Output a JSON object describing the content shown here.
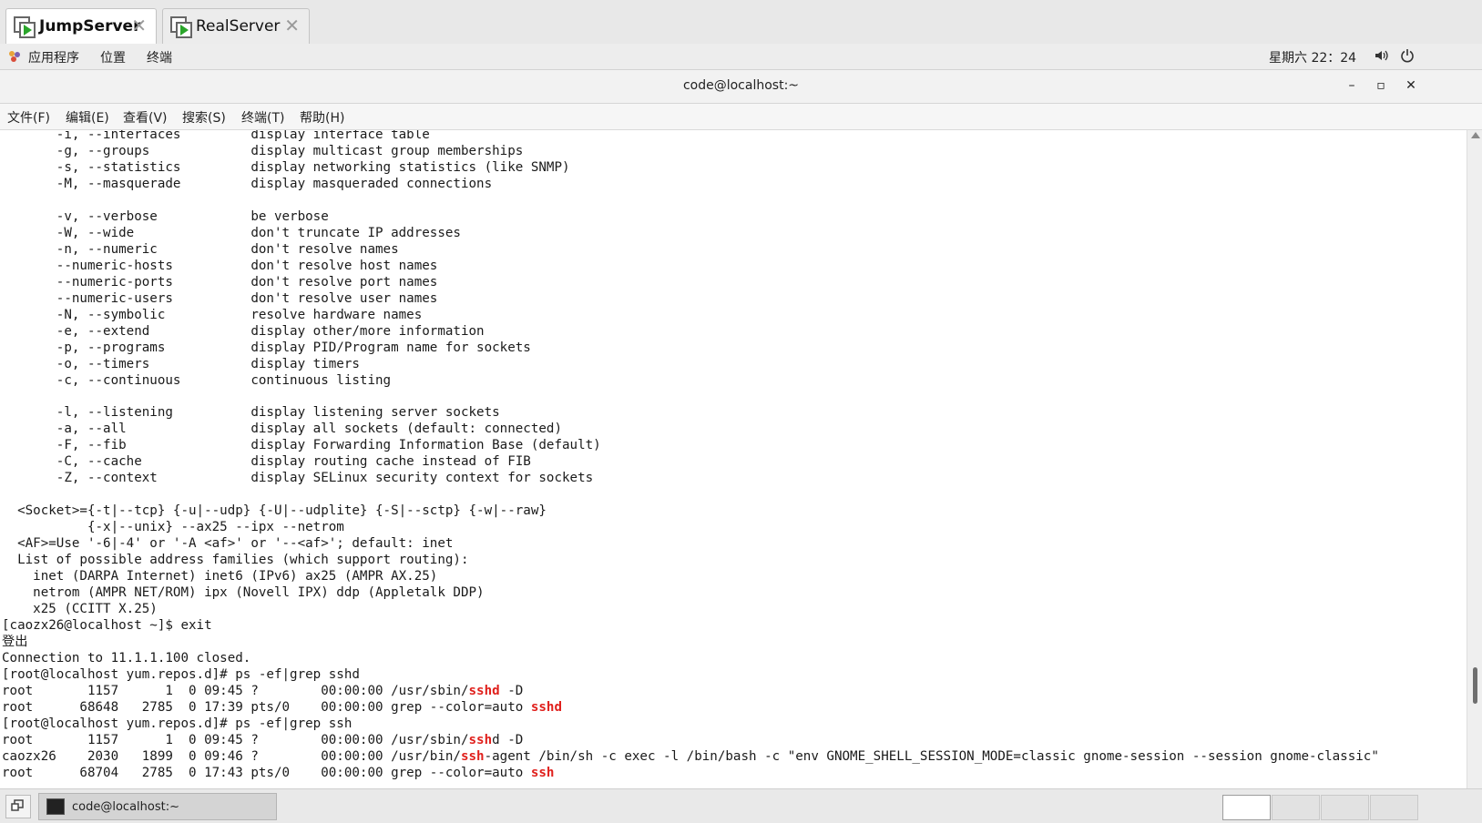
{
  "tabs": [
    {
      "label": "JumpServer",
      "active": true
    },
    {
      "label": "RealServer",
      "active": false
    }
  ],
  "topbar": {
    "apps": "应用程序",
    "places": "位置",
    "terminal": "终端",
    "clock": "星期六 22：24"
  },
  "window": {
    "title": "code@localhost:~"
  },
  "menu": [
    "文件(F)",
    "编辑(E)",
    "查看(V)",
    "搜索(S)",
    "终端(T)",
    "帮助(H)"
  ],
  "terminal_lines": [
    [
      {
        "t": "       -i, --interfaces         display interface table"
      }
    ],
    [
      {
        "t": "       -g, --groups             display multicast group memberships"
      }
    ],
    [
      {
        "t": "       -s, --statistics         display networking statistics (like SNMP)"
      }
    ],
    [
      {
        "t": "       -M, --masquerade         display masqueraded connections"
      }
    ],
    [
      {
        "t": ""
      }
    ],
    [
      {
        "t": "       -v, --verbose            be verbose"
      }
    ],
    [
      {
        "t": "       -W, --wide               don't truncate IP addresses"
      }
    ],
    [
      {
        "t": "       -n, --numeric            don't resolve names"
      }
    ],
    [
      {
        "t": "       --numeric-hosts          don't resolve host names"
      }
    ],
    [
      {
        "t": "       --numeric-ports          don't resolve port names"
      }
    ],
    [
      {
        "t": "       --numeric-users          don't resolve user names"
      }
    ],
    [
      {
        "t": "       -N, --symbolic           resolve hardware names"
      }
    ],
    [
      {
        "t": "       -e, --extend             display other/more information"
      }
    ],
    [
      {
        "t": "       -p, --programs           display PID/Program name for sockets"
      }
    ],
    [
      {
        "t": "       -o, --timers             display timers"
      }
    ],
    [
      {
        "t": "       -c, --continuous         continuous listing"
      }
    ],
    [
      {
        "t": ""
      }
    ],
    [
      {
        "t": "       -l, --listening          display listening server sockets"
      }
    ],
    [
      {
        "t": "       -a, --all                display all sockets (default: connected)"
      }
    ],
    [
      {
        "t": "       -F, --fib                display Forwarding Information Base (default)"
      }
    ],
    [
      {
        "t": "       -C, --cache              display routing cache instead of FIB"
      }
    ],
    [
      {
        "t": "       -Z, --context            display SELinux security context for sockets"
      }
    ],
    [
      {
        "t": ""
      }
    ],
    [
      {
        "t": "  <Socket>={-t|--tcp} {-u|--udp} {-U|--udplite} {-S|--sctp} {-w|--raw}"
      }
    ],
    [
      {
        "t": "           {-x|--unix} --ax25 --ipx --netrom"
      }
    ],
    [
      {
        "t": "  <AF>=Use '-6|-4' or '-A <af>' or '--<af>'; default: inet"
      }
    ],
    [
      {
        "t": "  List of possible address families (which support routing):"
      }
    ],
    [
      {
        "t": "    inet (DARPA Internet) inet6 (IPv6) ax25 (AMPR AX.25)"
      }
    ],
    [
      {
        "t": "    netrom (AMPR NET/ROM) ipx (Novell IPX) ddp (Appletalk DDP)"
      }
    ],
    [
      {
        "t": "    x25 (CCITT X.25)"
      }
    ],
    [
      {
        "t": "[caozx26@localhost ~]$ exit"
      }
    ],
    [
      {
        "t": "登出"
      }
    ],
    [
      {
        "t": "Connection to 11.1.1.100 closed."
      }
    ],
    [
      {
        "t": "[root@localhost yum.repos.d]# ps -ef|grep sshd"
      }
    ],
    [
      {
        "t": "root       1157      1  0 09:45 ?        00:00:00 /usr/sbin/"
      },
      {
        "t": "sshd",
        "h": true
      },
      {
        "t": " -D"
      }
    ],
    [
      {
        "t": "root      68648   2785  0 17:39 pts/0    00:00:00 grep --color=auto "
      },
      {
        "t": "sshd",
        "h": true
      }
    ],
    [
      {
        "t": "[root@localhost yum.repos.d]# ps -ef|grep ssh"
      }
    ],
    [
      {
        "t": "root       1157      1  0 09:45 ?        00:00:00 /usr/sbin/"
      },
      {
        "t": "ssh",
        "h": true
      },
      {
        "t": "d -D"
      }
    ],
    [
      {
        "t": "caozx26    2030   1899  0 09:46 ?        00:00:00 /usr/bin/"
      },
      {
        "t": "ssh",
        "h": true
      },
      {
        "t": "-agent /bin/sh -c exec -l /bin/bash -c \"env GNOME_SHELL_SESSION_MODE=classic gnome-session --session gnome-classic\""
      }
    ],
    [
      {
        "t": "root      68704   2785  0 17:43 pts/0    00:00:00 grep --color=auto "
      },
      {
        "t": "ssh",
        "h": true
      }
    ]
  ],
  "taskbar": {
    "task_label": "code@localhost:~"
  },
  "colors": {
    "highlight": "#e0201c",
    "tab_play": "#2aa52a"
  }
}
